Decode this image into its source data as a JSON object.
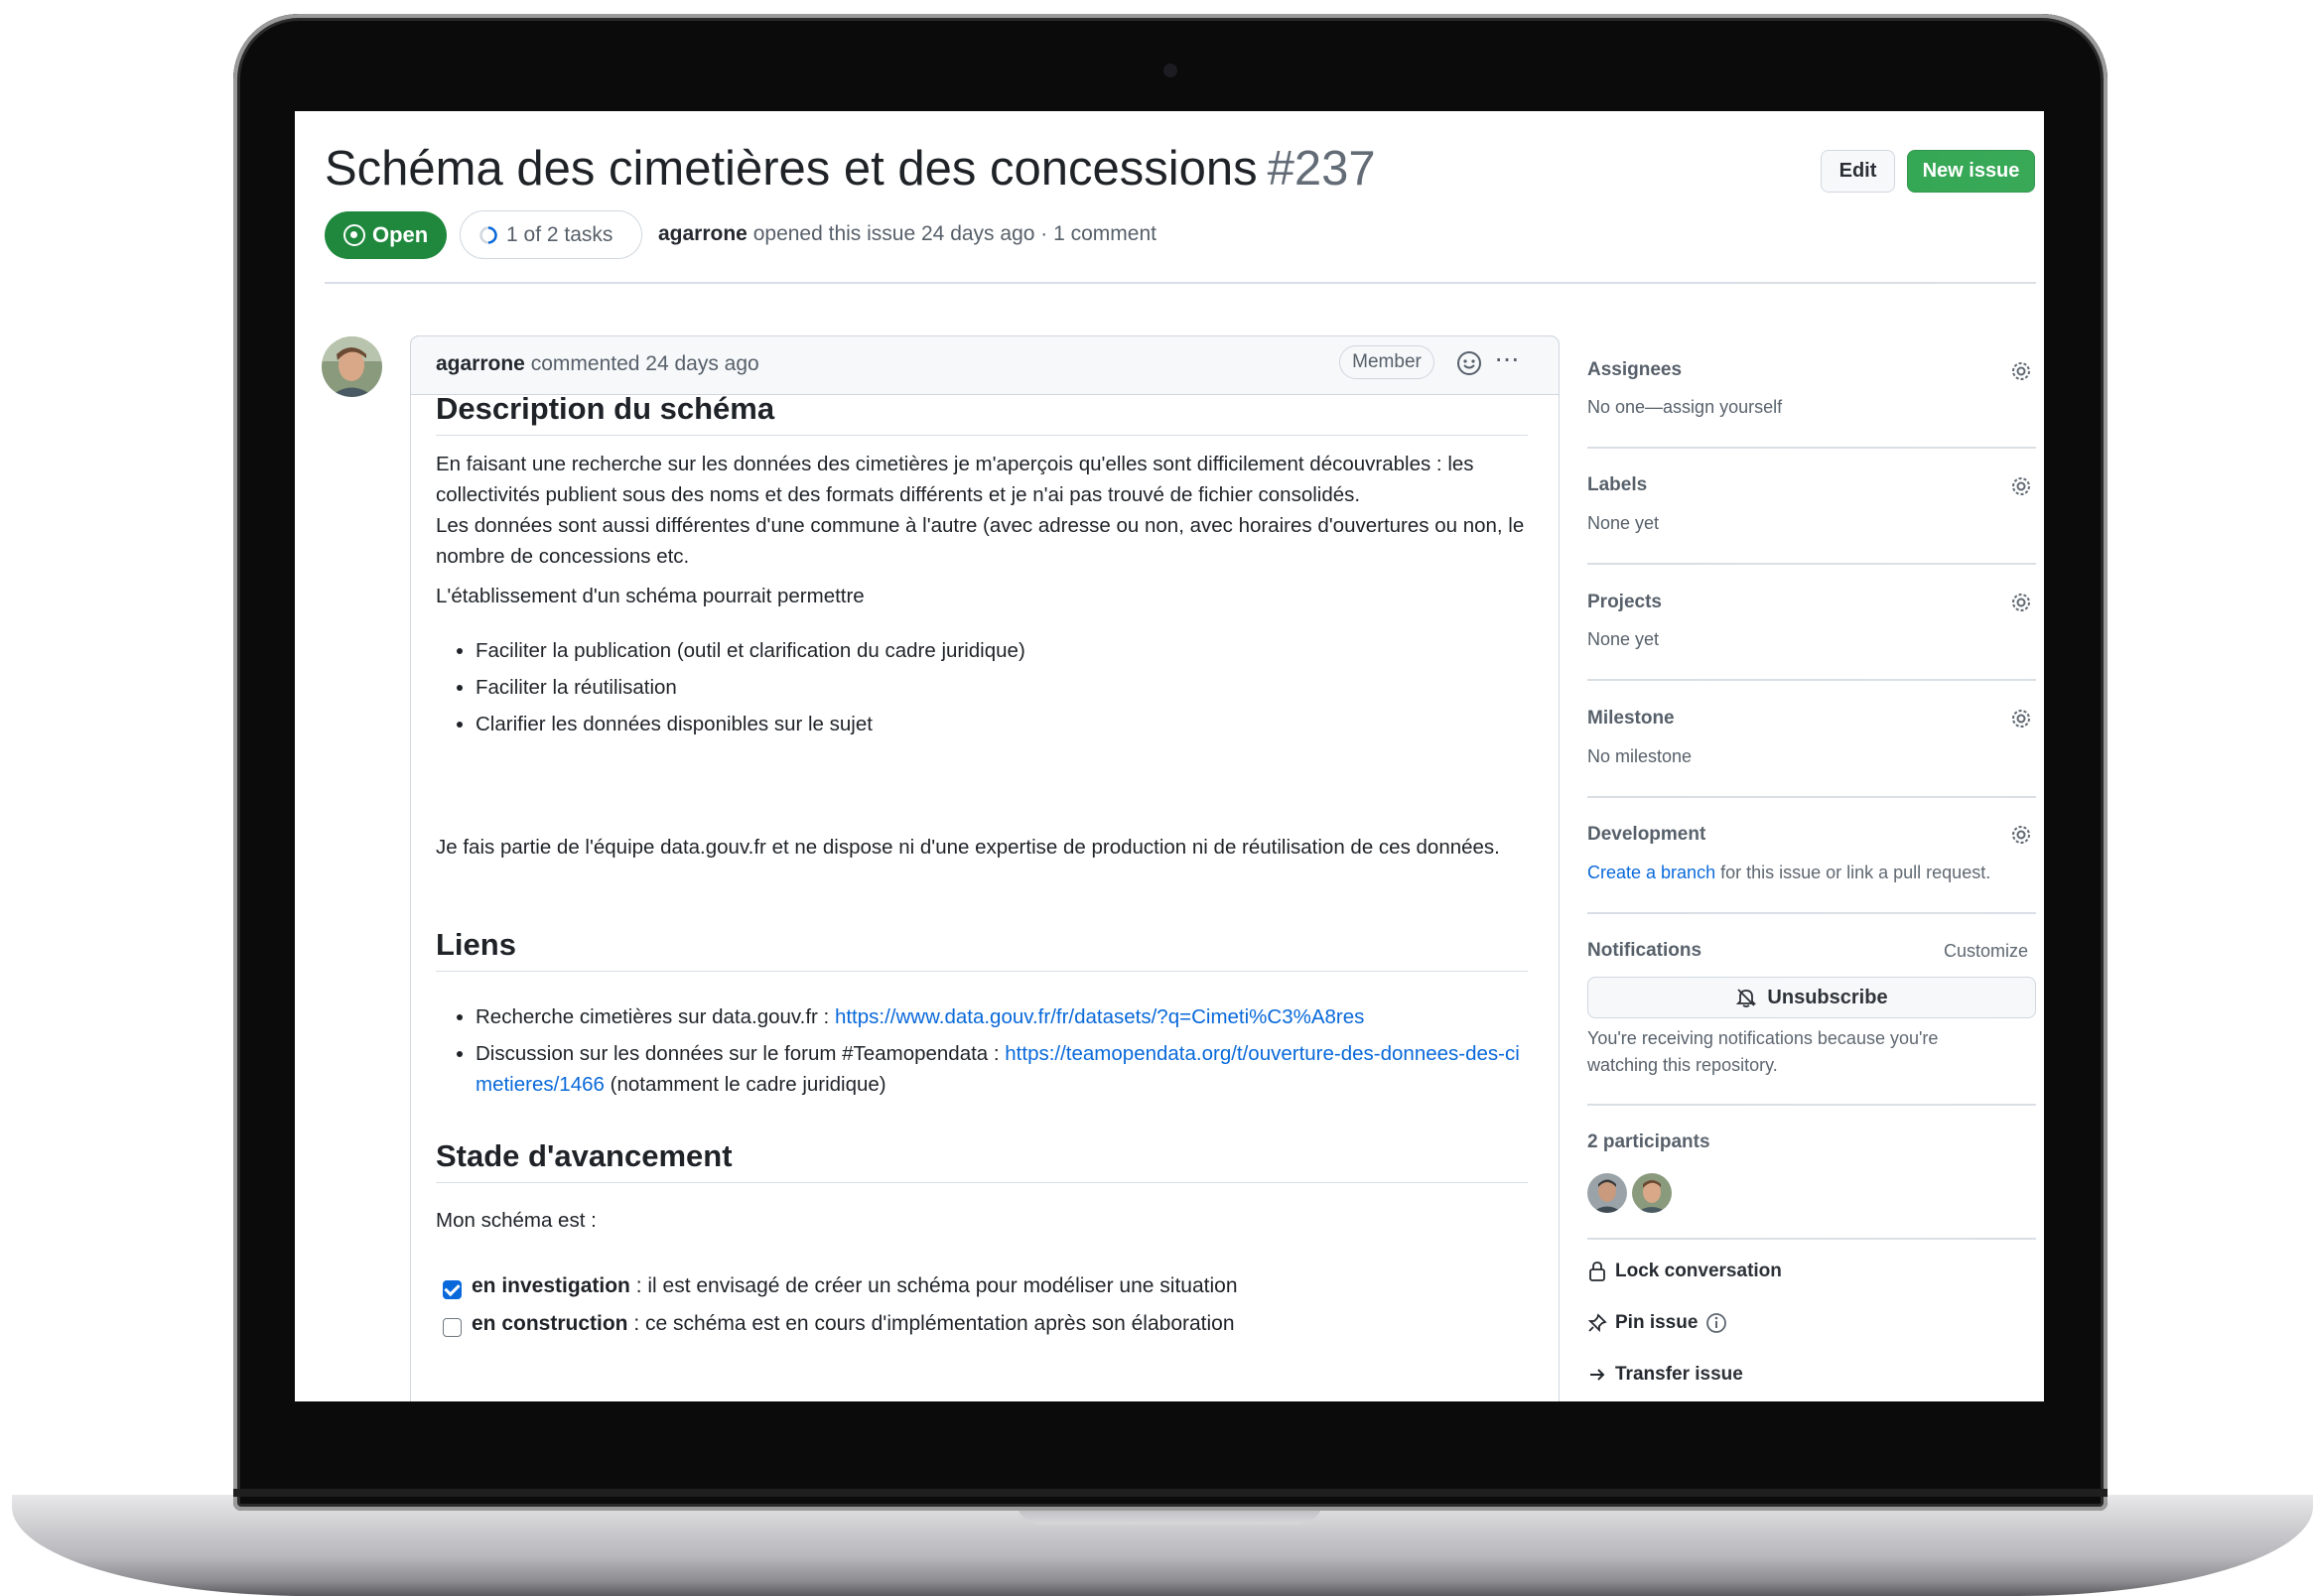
{
  "issue": {
    "title": "Schéma des cimetières et des concessions",
    "number": "#237",
    "state": "Open",
    "tasks": "1 of 2 tasks",
    "author": "agarrone",
    "opened_text": "opened this issue 24 days ago · 1 comment",
    "edit_label": "Edit",
    "new_issue_label": "New issue"
  },
  "comment": {
    "author": "agarrone",
    "time_text": "commented 24 days ago",
    "badge": "Member",
    "h_description": "Description du schéma",
    "p1": "En faisant une recherche sur les données des cimetières je m'aperçois qu'elles sont difficilement découvrables : les collectivités publient sous des noms et des formats différents et je n'ai pas trouvé de fichier consolidés.",
    "p1b": "Les données sont aussi différentes d'une commune à l'autre (avec adresse ou non, avec horaires d'ouvertures ou non, le nombre de concessions etc.",
    "p2": "L'établissement d'un schéma pourrait permettre",
    "bullets": [
      "Faciliter la publication (outil et clarification du cadre juridique)",
      "Faciliter la réutilisation",
      "Clarifier les données disponibles sur le sujet"
    ],
    "p3": "Je fais partie de l'équipe data.gouv.fr et ne dispose ni d'une expertise de production ni de réutilisation de ces données.",
    "h_links": "Liens",
    "link1_prefix": "Recherche cimetières sur data.gouv.fr : ",
    "link1_url": "https://www.data.gouv.fr/fr/datasets/?q=Cimeti%C3%A8res",
    "link2_prefix": "Discussion sur les données sur le forum #Teamopendata : ",
    "link2_url": "https://teamopendata.org/t/ouverture-des-donnees-des-cimetieres/1466",
    "link2_suffix": " (notamment le cadre juridique)",
    "h_stage": "Stade d'avancement",
    "p4": "Mon schéma est :",
    "task1_bold": "en investigation",
    "task1_rest": " : il est envisagé de créer un schéma pour modéliser une situation",
    "task1_checked": true,
    "task2_bold": "en construction",
    "task2_rest": " : ce schéma est en cours d'implémentation après son élaboration",
    "task2_checked": false
  },
  "sidebar": {
    "assignees_h": "Assignees",
    "assignees_v": "No one—assign yourself",
    "labels_h": "Labels",
    "labels_v": "None yet",
    "projects_h": "Projects",
    "projects_v": "None yet",
    "milestone_h": "Milestone",
    "milestone_v": "No milestone",
    "development_h": "Development",
    "development_link": "Create a branch",
    "development_rest": " for this issue or link a pull request.",
    "notifications_h": "Notifications",
    "customize": "Customize",
    "unsubscribe": "Unsubscribe",
    "notif_reason_1": "You're receiving notifications because you're",
    "notif_reason_2": "watching this repository.",
    "participants_h": "2 participants",
    "lock": "Lock conversation",
    "pin": "Pin issue",
    "transfer": "Transfer issue"
  },
  "colors": {
    "green": "#1f883d",
    "link": "#0969da",
    "muted": "#57606a",
    "border": "#d0d7de"
  }
}
